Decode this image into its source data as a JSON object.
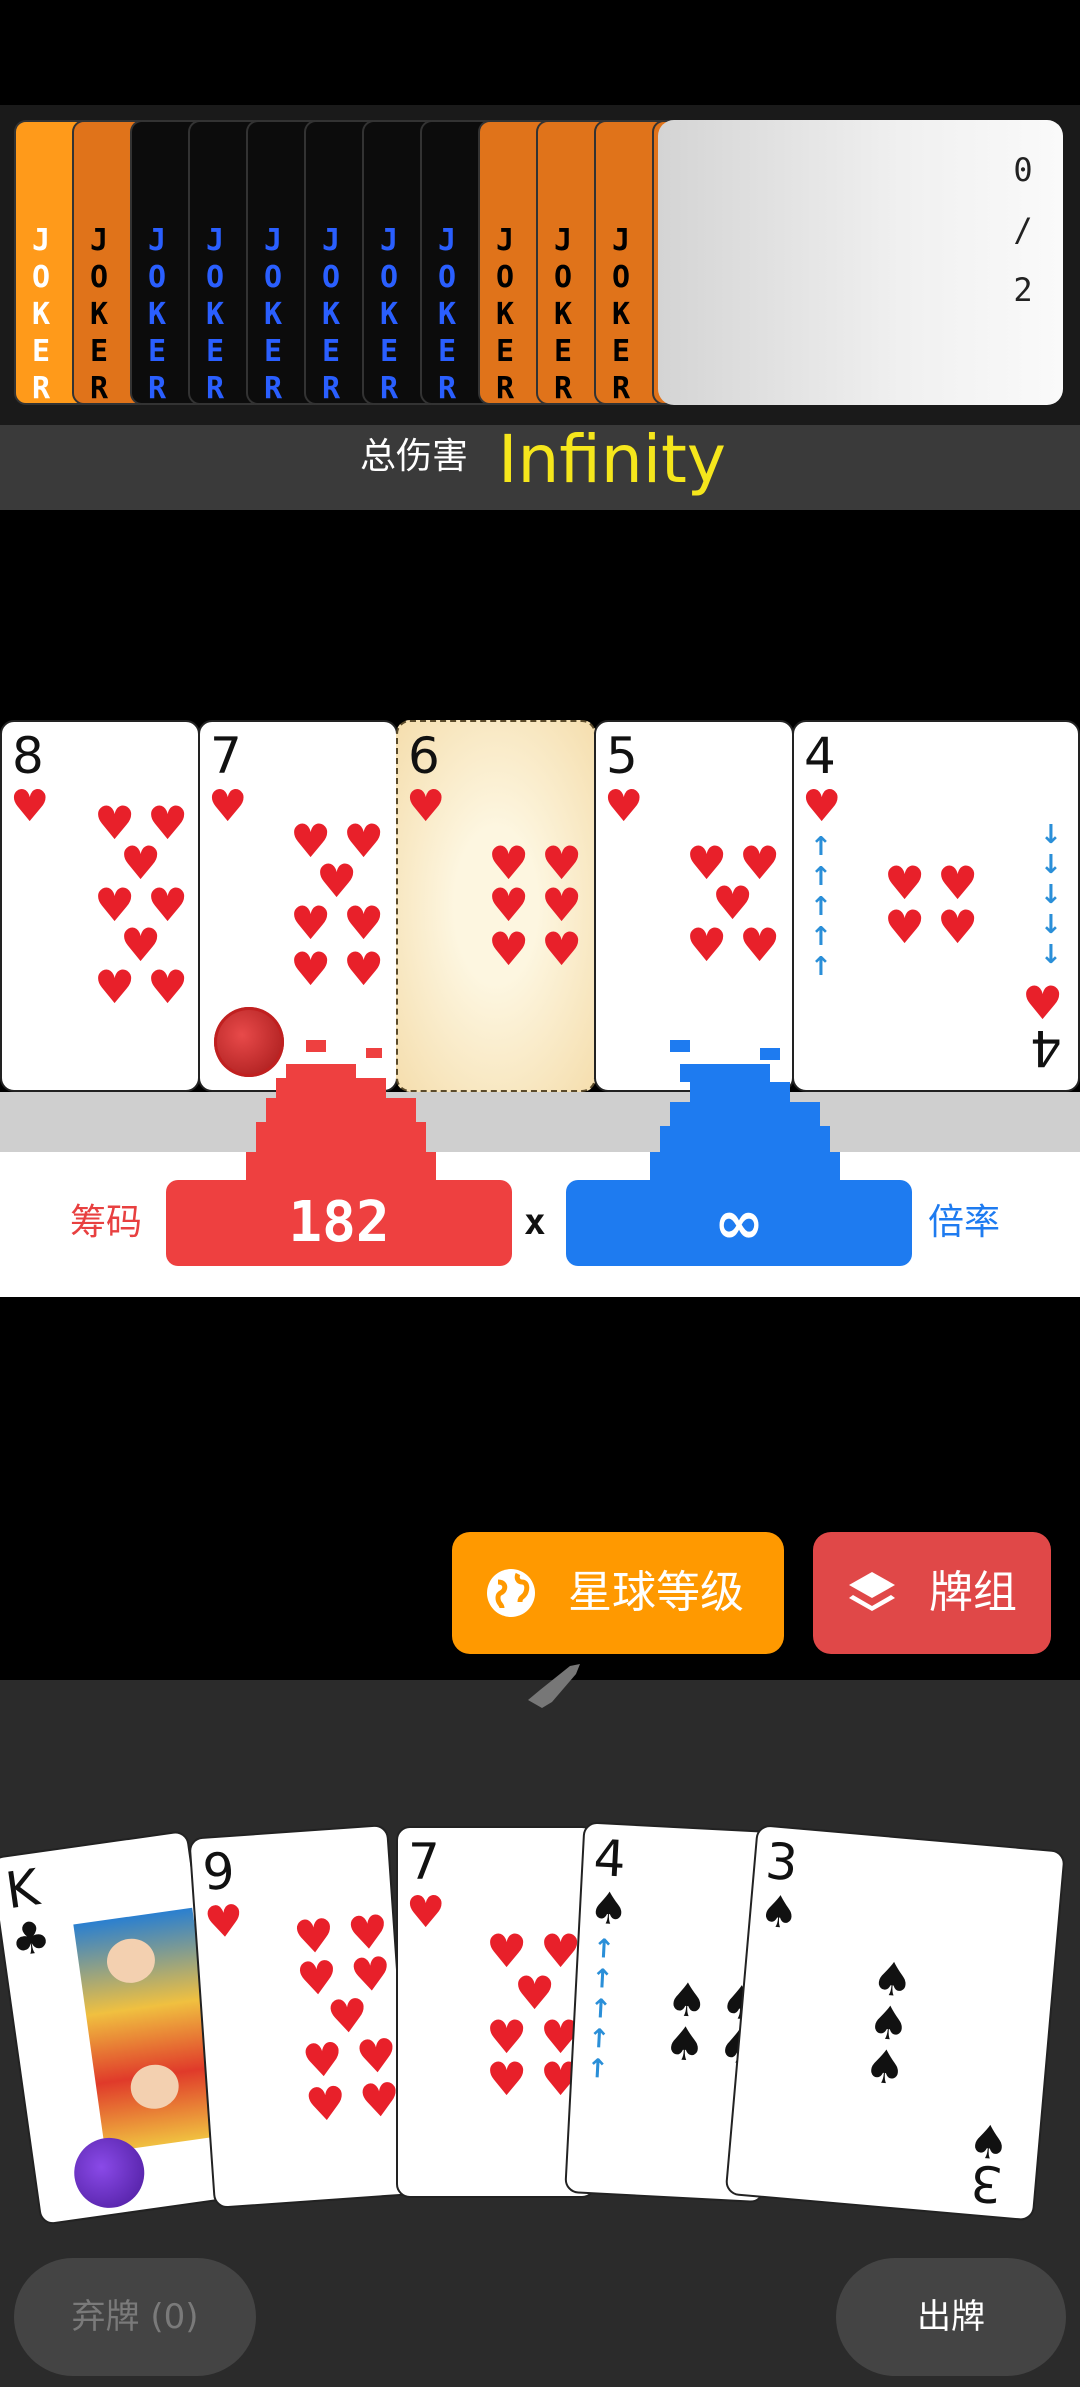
{
  "joker_strip": {
    "joker_label": "JOKER",
    "jokers": [
      {
        "color": "#ff9a1a",
        "text_color": "#ffffff"
      },
      {
        "color": "#e0731a",
        "text_color": "#000000"
      },
      {
        "color": "#0c0c0c",
        "text_color": "#2a5fff"
      },
      {
        "color": "#0c0c0c",
        "text_color": "#2a5fff"
      },
      {
        "color": "#0c0c0c",
        "text_color": "#2a5fff"
      },
      {
        "color": "#0c0c0c",
        "text_color": "#2a5fff"
      },
      {
        "color": "#0c0c0c",
        "text_color": "#2a5fff"
      },
      {
        "color": "#0c0c0c",
        "text_color": "#2a5fff"
      },
      {
        "color": "#e0731a",
        "text_color": "#000000"
      },
      {
        "color": "#e0731a",
        "text_color": "#000000"
      },
      {
        "color": "#e0731a",
        "text_color": "#000000"
      },
      {
        "color": "#e0731a",
        "text_color": "#000000"
      }
    ],
    "slot_count_current": "0",
    "slot_count_sep": "/",
    "slot_count_max": "2"
  },
  "damage": {
    "label": "总伤害",
    "value": "Infinity"
  },
  "played_cards": [
    {
      "rank": "8",
      "suit": "heart"
    },
    {
      "rank": "7",
      "suit": "heart"
    },
    {
      "rank": "6",
      "suit": "heart"
    },
    {
      "rank": "5",
      "suit": "heart"
    },
    {
      "rank": "4",
      "suit": "heart",
      "corner_rank": "4"
    }
  ],
  "score": {
    "chips_label": "筹码",
    "chips_value": "182",
    "times": "x",
    "mult_value": "∞",
    "mult_label": "倍率",
    "chips_color": "#ee4040",
    "mult_color": "#1e7bf0"
  },
  "buttons": {
    "planet_label": "星球等级",
    "deck_label": "牌组",
    "discard_label": "弃牌 (0)",
    "play_label": "出牌"
  },
  "hand_cards": [
    {
      "rank": "K",
      "suit": "club"
    },
    {
      "rank": "9",
      "suit": "heart"
    },
    {
      "rank": "7",
      "suit": "heart"
    },
    {
      "rank": "4",
      "suit": "spade"
    },
    {
      "rank": "3",
      "suit": "spade",
      "corner_rank": "3"
    }
  ],
  "suit_glyphs": {
    "heart": "♥",
    "spade": "♠",
    "club": "♣"
  }
}
